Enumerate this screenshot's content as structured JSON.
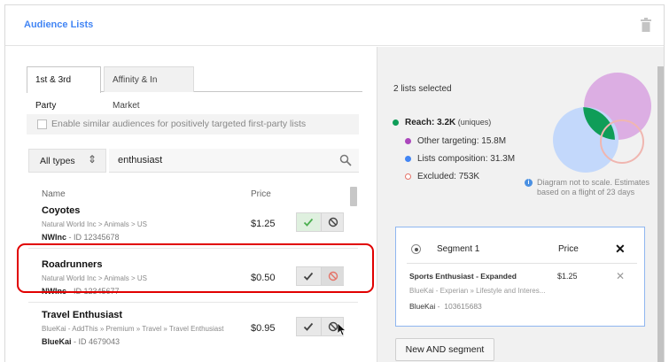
{
  "header": {
    "title": "Audience Lists"
  },
  "tabs": [
    {
      "label": "1st & 3rd Party",
      "active": true
    },
    {
      "label": "Affinity & In Market",
      "active": false
    }
  ],
  "similar_checkbox": {
    "label": "Enable similar audiences for positively targeted first-party lists",
    "checked": false
  },
  "filter": {
    "type_label": "All types",
    "type_arrow": "⇕",
    "search_value": "enthusiast"
  },
  "columns": {
    "name": "Name",
    "price": "Price"
  },
  "rows": [
    {
      "name": "Coyotes",
      "path": "Natural World Inc > Animals > US",
      "provider": "NWInc",
      "id_text": " - ID 12345678",
      "price": "$1.25",
      "state": "included"
    },
    {
      "name": "Roadrunners",
      "path": "Natural World Inc > Animals > US",
      "provider": "NWInc",
      "id_text": " - ID 12345677",
      "price": "$0.50",
      "state": "excluded-hover"
    },
    {
      "name": "Travel Enthusiast",
      "path": "BlueKai - AddThis » Premium » Travel » Travel Enthusiast",
      "provider": "BlueKai",
      "id_text": " - ID 4679043",
      "price": "$0.95",
      "state": "none"
    }
  ],
  "summary": {
    "selected": "2 lists selected",
    "reach_label": "Reach: 3.2K",
    "reach_sub": " (uniques)",
    "other_targeting": "Other targeting: 15.8M",
    "lists_composition": "Lists composition: 31.3M",
    "excluded": "Excluded: 753K",
    "note": "Diagram not to scale. Estimates based on a flight of 23 days",
    "colors": {
      "reach": "#0f9d58",
      "other": "#ab47bc",
      "composition": "#4285f4",
      "excluded": "#e57368"
    }
  },
  "segment": {
    "title": "Segment 1",
    "price_header": "Price",
    "close": "✕",
    "item_name": "Sports Enthusiast - Expanded",
    "item_price": "$1.25",
    "item_remove": "✕",
    "item_path": "BlueKai - Experian » Lifestyle and Interes...",
    "item_provider": "BlueKai",
    "item_id": "103615683"
  },
  "new_segment_button": "New AND segment"
}
